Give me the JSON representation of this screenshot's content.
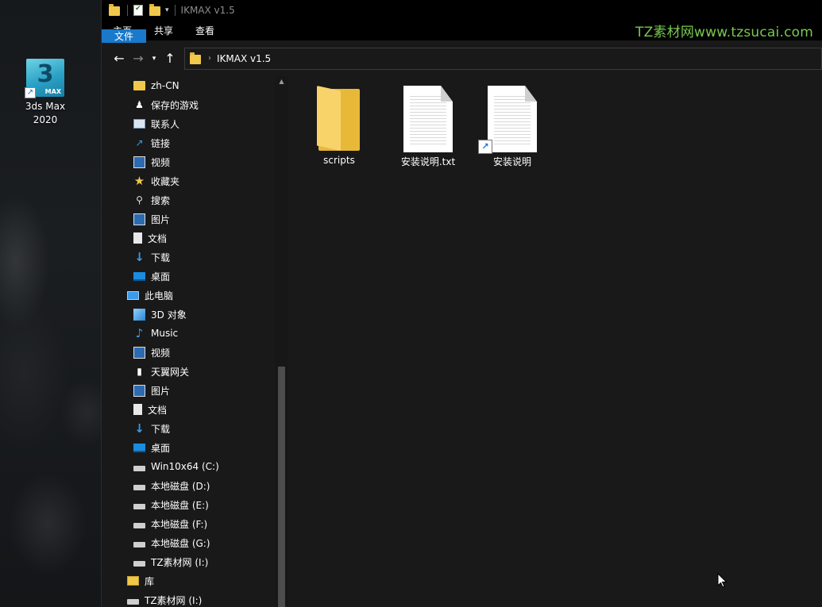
{
  "desktop": {
    "icon_label_line1": "3ds Max",
    "icon_label_line2": "2020",
    "icon_tile_number": "3",
    "icon_tile_sub": "MAX"
  },
  "window": {
    "title": "IKMAX v1.5",
    "watermark": "TZ素材网www.tzsucai.com",
    "ribbon_tabs": [
      "文件",
      "主页",
      "共享",
      "查看"
    ],
    "address_path": "IKMAX v1.5",
    "accent": "#1979ca"
  },
  "navpane": {
    "items": [
      {
        "label": "zh-CN",
        "icon": "folder-icon"
      },
      {
        "label": "保存的游戏",
        "icon": "saved-games-icon"
      },
      {
        "label": "联系人",
        "icon": "contacts-icon"
      },
      {
        "label": "链接",
        "icon": "links-icon"
      },
      {
        "label": "视频",
        "icon": "videos-icon"
      },
      {
        "label": "收藏夹",
        "icon": "favorites-star-icon"
      },
      {
        "label": "搜索",
        "icon": "search-icon"
      },
      {
        "label": "图片",
        "icon": "pictures-icon"
      },
      {
        "label": "文档",
        "icon": "documents-icon"
      },
      {
        "label": "下载",
        "icon": "download-arrow-icon"
      },
      {
        "label": "桌面",
        "icon": "desktop-icon"
      },
      {
        "label": "此电脑",
        "icon": "this-pc-icon"
      },
      {
        "label": "3D 对象",
        "icon": "3d-objects-icon"
      },
      {
        "label": "Music",
        "icon": "music-note-icon"
      },
      {
        "label": "视频",
        "icon": "videos-icon"
      },
      {
        "label": "天翼网关",
        "icon": "network-device-icon"
      },
      {
        "label": "图片",
        "icon": "pictures-icon"
      },
      {
        "label": "文档",
        "icon": "documents-icon"
      },
      {
        "label": "下载",
        "icon": "download-arrow-icon"
      },
      {
        "label": "桌面",
        "icon": "desktop-icon"
      },
      {
        "label": "Win10x64 (C:)",
        "icon": "system-drive-icon"
      },
      {
        "label": "本地磁盘 (D:)",
        "icon": "drive-icon"
      },
      {
        "label": "本地磁盘 (E:)",
        "icon": "drive-icon"
      },
      {
        "label": "本地磁盘 (F:)",
        "icon": "drive-icon"
      },
      {
        "label": "本地磁盘 (G:)",
        "icon": "drive-icon"
      },
      {
        "label": "TZ素材网 (I:)",
        "icon": "drive-icon"
      },
      {
        "label": "库",
        "icon": "library-icon"
      },
      {
        "label": "TZ素材网 (I:)",
        "icon": "drive-icon"
      }
    ]
  },
  "content": {
    "files": [
      {
        "name": "scripts",
        "type": "folder"
      },
      {
        "name": "安装说明.txt",
        "type": "text-document"
      },
      {
        "name": "安装说明",
        "type": "shortcut"
      }
    ]
  }
}
